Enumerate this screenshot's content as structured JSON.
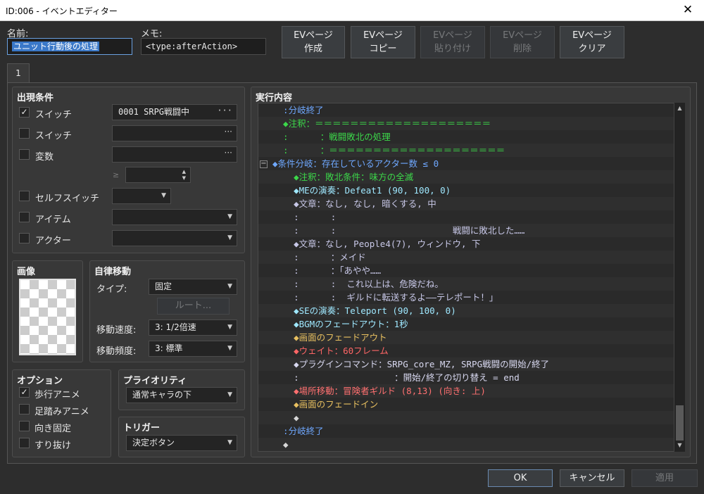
{
  "window": {
    "title": "ID:006 - イベントエディター",
    "close": "✕"
  },
  "header": {
    "name_label": "名前:",
    "name_value": "ユニット行動後の処理",
    "memo_label": "メモ:",
    "memo_value": "<type:afterAction>",
    "buttons": [
      {
        "line1": "EVページ",
        "line2": "作成",
        "enabled": true
      },
      {
        "line1": "EVページ",
        "line2": "コピー",
        "enabled": true
      },
      {
        "line1": "EVページ",
        "line2": "貼り付け",
        "enabled": false
      },
      {
        "line1": "EVページ",
        "line2": "削除",
        "enabled": false
      },
      {
        "line1": "EVページ",
        "line2": "クリア",
        "enabled": true
      }
    ]
  },
  "tabs": [
    "1"
  ],
  "conditions": {
    "title": "出現条件",
    "rows": [
      {
        "label": "スイッチ",
        "checked": true,
        "value": "0001 SRPG戦闘中"
      },
      {
        "label": "スイッチ",
        "checked": false,
        "value": ""
      },
      {
        "label": "変数",
        "checked": false,
        "value": ""
      },
      {
        "label": "セルフスイッチ",
        "checked": false,
        "value": ""
      },
      {
        "label": "アイテム",
        "checked": false,
        "value": ""
      },
      {
        "label": "アクター",
        "checked": false,
        "value": ""
      }
    ],
    "ge_symbol": "≥",
    "check_mark": "✓"
  },
  "image": {
    "title": "画像"
  },
  "autonomous": {
    "title": "自律移動",
    "type_label": "タイプ:",
    "type_value": "固定",
    "route_button": "ルート...",
    "speed_label": "移動速度:",
    "speed_value": "3: 1/2倍速",
    "freq_label": "移動頻度:",
    "freq_value": "3: 標準"
  },
  "options": {
    "title": "オプション",
    "items": [
      {
        "label": "歩行アニメ",
        "checked": true
      },
      {
        "label": "足踏みアニメ",
        "checked": false
      },
      {
        "label": "向き固定",
        "checked": false
      },
      {
        "label": "すり抜け",
        "checked": false
      }
    ]
  },
  "priority": {
    "title": "プライオリティ",
    "value": "通常キャラの下"
  },
  "trigger": {
    "title": "トリガー",
    "value": "決定ボタン"
  },
  "contents": {
    "title": "実行内容",
    "lines": [
      {
        "text": "  :分岐終了",
        "color": "#6fa8ff"
      },
      {
        "text": "  ◆注釈：＝＝＝＝＝＝＝＝＝＝＝＝＝＝＝＝＝＝＝＝",
        "color": "#3cd84a"
      },
      {
        "text": "  :      ：戦闘敗北の処理",
        "color": "#3cd84a"
      },
      {
        "text": "  :      ：＝＝＝＝＝＝＝＝＝＝＝＝＝＝＝＝＝＝＝＝",
        "color": "#3cd84a"
      },
      {
        "text": "◆条件分岐：存在しているアクター数 ≤ 0",
        "color": "#6fa8ff"
      },
      {
        "text": "    ◆注釈：敗北条件：味方の全滅",
        "color": "#3cd84a"
      },
      {
        "text": "    ◆MEの演奏：Defeat1 (90, 100, 0)",
        "color": "#9fe8ff"
      },
      {
        "text": "    ◆文章：なし, なし, 暗くする, 中",
        "color": "#c8c8e8"
      },
      {
        "text": "    :      :",
        "color": "#c8c8e8"
      },
      {
        "text": "    :      :                      戦闘に敗北した……",
        "color": "#c8c8e8"
      },
      {
        "text": "    ◆文章：なし, People4(7), ウィンドウ, 下",
        "color": "#c8c8e8"
      },
      {
        "text": "    :      ：メイド",
        "color": "#c8c8e8"
      },
      {
        "text": "    :      ：「あやや……",
        "color": "#c8c8e8"
      },
      {
        "text": "    :      :  これ以上は、危険だね。",
        "color": "#c8c8e8"
      },
      {
        "text": "    :      :  ギルドに転送するよ——テレポート！」",
        "color": "#c8c8e8"
      },
      {
        "text": "    ◆SEの演奏：Teleport (90, 100, 0)",
        "color": "#9fe8ff"
      },
      {
        "text": "    ◆BGMのフェードアウト：1秒",
        "color": "#9fe8ff"
      },
      {
        "text": "    ◆画面のフェードアウト",
        "color": "#e8c060"
      },
      {
        "text": "    ◆ウェイト：60フレーム",
        "color": "#ff6666"
      },
      {
        "text": "    ◆プラグインコマンド：SRPG_core_MZ, SRPG戦闘の開始/終了",
        "color": "#d8d8f0"
      },
      {
        "text": "    :                  ：開始/終了の切り替え = end",
        "color": "#d8d8f0"
      },
      {
        "text": "    ◆場所移動：冒険者ギルド (8,13) (向き: 上)",
        "color": "#ff7070"
      },
      {
        "text": "    ◆画面のフェードイン",
        "color": "#e8c060"
      },
      {
        "text": "    ◆",
        "color": "#d8d8d8"
      },
      {
        "text": "  :分岐終了",
        "color": "#6fa8ff"
      },
      {
        "text": "  ◆",
        "color": "#d8d8d8"
      }
    ],
    "collapse_symbol": "−"
  },
  "footer": {
    "ok": "OK",
    "cancel": "キャンセル",
    "apply": "適用"
  },
  "colors": {
    "selection": "#3a78c8",
    "bg": "#2d2d2d"
  }
}
